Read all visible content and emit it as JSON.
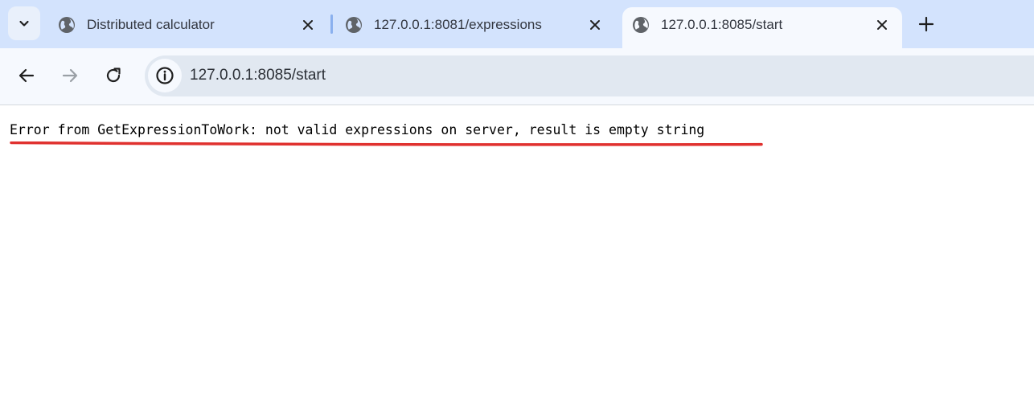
{
  "tabs": [
    {
      "title": "Distributed calculator",
      "active": false,
      "icon": "globe-icon"
    },
    {
      "title": "127.0.0.1:8081/expressions",
      "active": false,
      "icon": "globe-icon"
    },
    {
      "title": "127.0.0.1:8085/start",
      "active": true,
      "icon": "globe-icon"
    }
  ],
  "toolbar": {
    "url": "127.0.0.1:8085/start"
  },
  "page": {
    "error_text": "Error from GetExpressionToWork: not valid expressions on server, result is empty string"
  },
  "colors": {
    "tabstrip": "#d3e3fd",
    "toolbar": "#f6f9fe",
    "omnibox": "#e1e8f1",
    "annotation_underline": "#e0312f"
  }
}
